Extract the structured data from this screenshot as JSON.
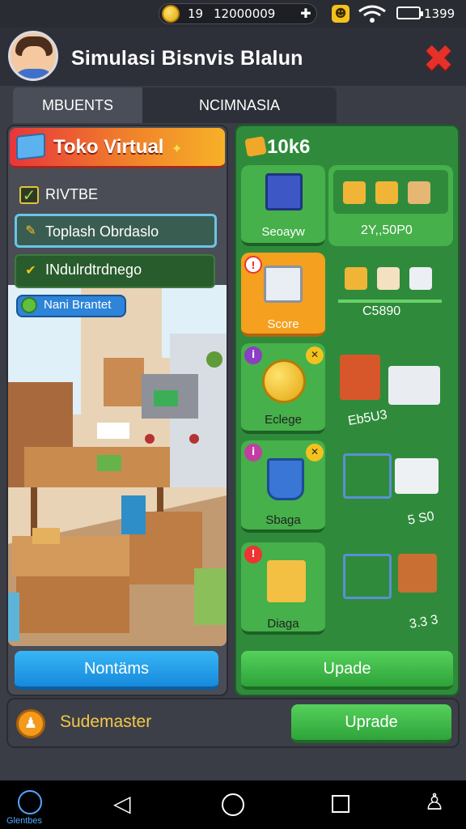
{
  "status_bar": {
    "coin_value": "19",
    "coin_total": "12000009",
    "plus_icon": "plus-icon",
    "clock": "1399",
    "icons": [
      "coin-icon",
      "emoji-icon",
      "wifi-icon",
      "battery-icon"
    ]
  },
  "header": {
    "title": "Simulasi Bisnvis Blalun",
    "close_icon": "close-icon",
    "avatar_icon": "avatar"
  },
  "tabs": [
    {
      "label": "MBUENTS"
    },
    {
      "label": "NCIMNASIA"
    }
  ],
  "left_panel": {
    "shop_title": "Toko Virtual",
    "section_label": "RIVTBE",
    "items": [
      {
        "label": "Toplash Obrdaslo"
      },
      {
        "label": "INdulrdtrdnego"
      }
    ],
    "chip_label": "Nani Brantet",
    "bottom_button": "Nontäms"
  },
  "right_panel": {
    "title": "10k6",
    "cards": [
      {
        "label": "Seoayw",
        "price": "2Y,,50P0"
      },
      {
        "label": "Score",
        "price": "C5890"
      },
      {
        "label": "Eclege",
        "price": "Eb5U3"
      },
      {
        "label": "Sbaga",
        "price": "5 S0"
      },
      {
        "label": "Diaga",
        "price": "3.3 3"
      }
    ],
    "button": "Upade"
  },
  "footer": {
    "label": "Sudemaster",
    "button": "Uprade"
  },
  "navbar": {
    "left_label": "Glentbes",
    "icons": [
      "clock-icon",
      "back-icon",
      "home-icon",
      "recent-icon",
      "user-icon"
    ]
  },
  "colors": {
    "panel_green": "#2f8b3b",
    "button_blue": "#1689dc",
    "button_green": "#2ea33a",
    "accent_red": "#e5312a",
    "shop_orange": "#f0812b"
  }
}
